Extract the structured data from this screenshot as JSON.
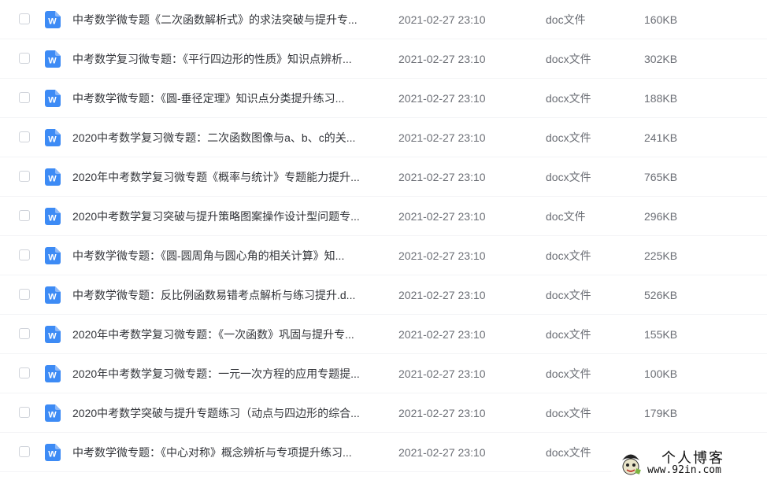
{
  "files": [
    {
      "name": "中考数学微专题《二次函数解析式》的求法突破与提升专...",
      "time": "2021-02-27 23:10",
      "type": "doc文件",
      "size": "160KB"
    },
    {
      "name": "中考数学复习微专题：《平行四边形的性质》知识点辨析...",
      "time": "2021-02-27 23:10",
      "type": "docx文件",
      "size": "302KB"
    },
    {
      "name": "中考数学微专题：《圆-垂径定理》知识点分类提升练习...",
      "time": "2021-02-27 23:10",
      "type": "docx文件",
      "size": "188KB"
    },
    {
      "name": "2020中考数学复习微专题：二次函数图像与a、b、c的关...",
      "time": "2021-02-27 23:10",
      "type": "docx文件",
      "size": "241KB"
    },
    {
      "name": "2020年中考数学复习微专题《概率与统计》专题能力提升...",
      "time": "2021-02-27 23:10",
      "type": "docx文件",
      "size": "765KB"
    },
    {
      "name": "2020中考数学复习突破与提升策略图案操作设计型问题专...",
      "time": "2021-02-27 23:10",
      "type": "doc文件",
      "size": "296KB"
    },
    {
      "name": "中考数学微专题：《圆-圆周角与圆心角的相关计算》知...",
      "time": "2021-02-27 23:10",
      "type": "docx文件",
      "size": "225KB"
    },
    {
      "name": "中考数学微专题：反比例函数易错考点解析与练习提升.d...",
      "time": "2021-02-27 23:10",
      "type": "docx文件",
      "size": "526KB"
    },
    {
      "name": "2020年中考数学复习微专题：《一次函数》巩固与提升专...",
      "time": "2021-02-27 23:10",
      "type": "docx文件",
      "size": "155KB"
    },
    {
      "name": "2020年中考数学复习微专题：一元一次方程的应用专题提...",
      "time": "2021-02-27 23:10",
      "type": "docx文件",
      "size": "100KB"
    },
    {
      "name": "2020中考数学突破与提升专题练习（动点与四边形的综合...",
      "time": "2021-02-27 23:10",
      "type": "docx文件",
      "size": "179KB"
    },
    {
      "name": "中考数学微专题：《中心对称》概念辨析与专项提升练习...",
      "time": "2021-02-27 23:10",
      "type": "docx文件",
      "size": ""
    }
  ],
  "file_icon": {
    "name": "word-doc-icon",
    "glyph": "W",
    "color": "#3d8bf5"
  },
  "watermark": {
    "title": "个人博客",
    "url": "www.92in.com"
  }
}
